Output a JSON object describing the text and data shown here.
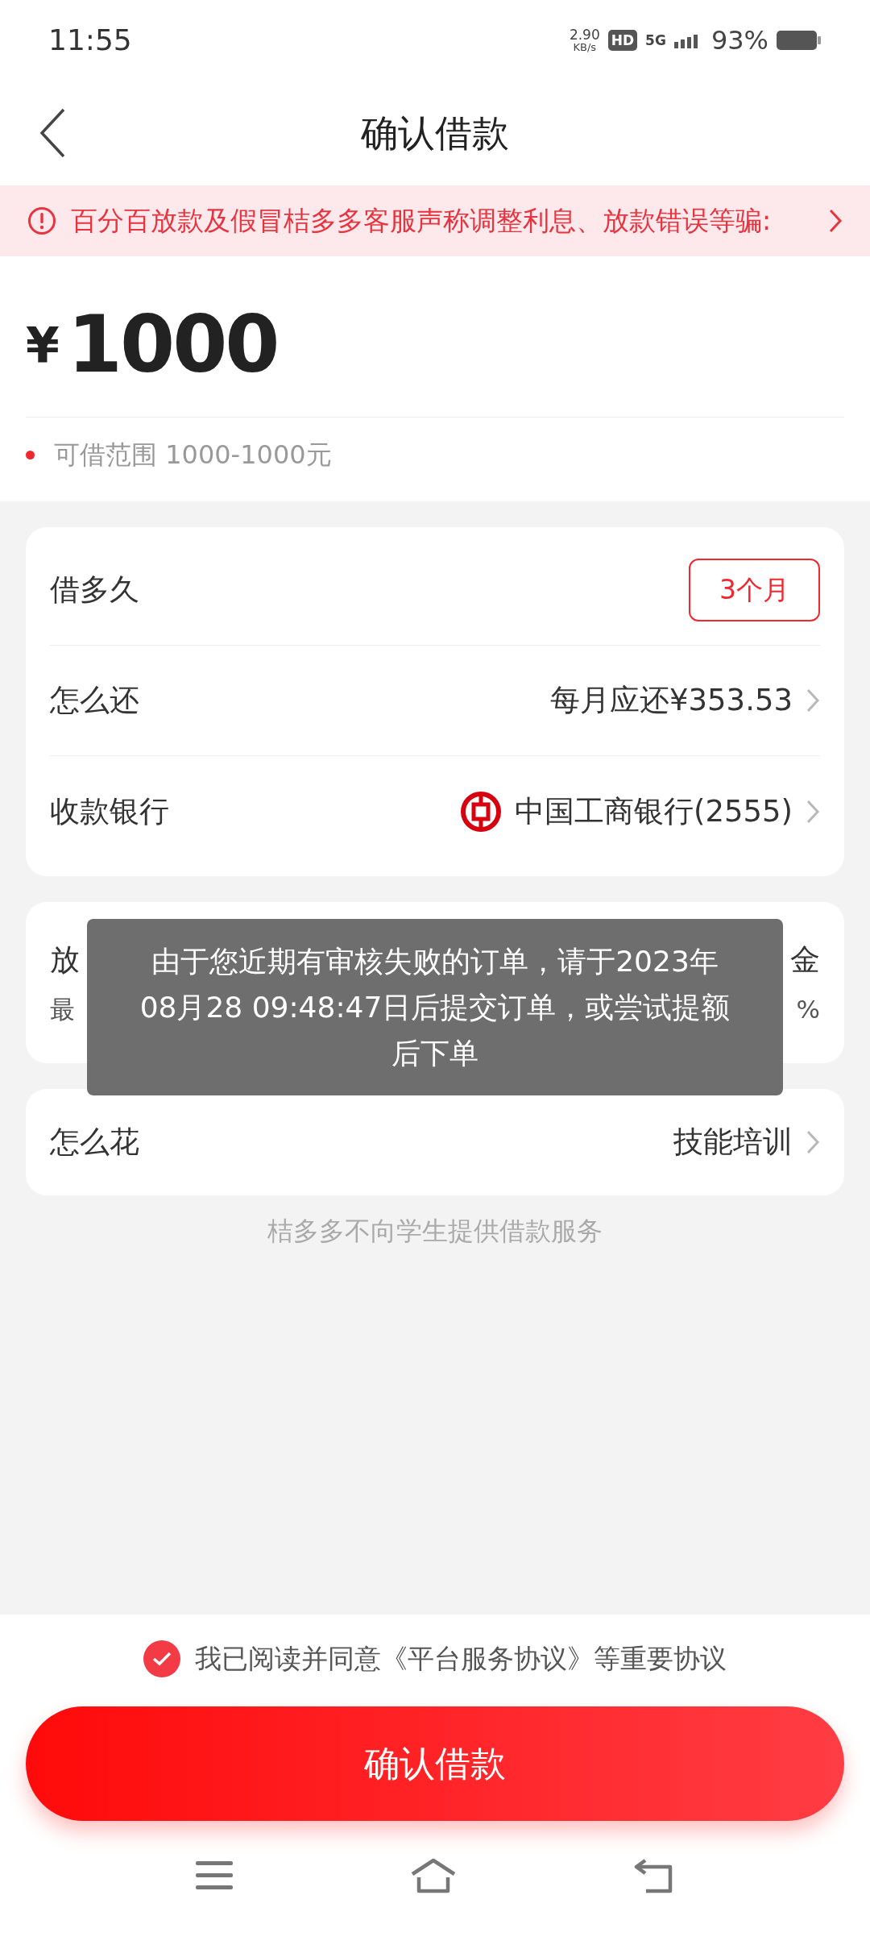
{
  "status_bar": {
    "time": "11:55",
    "net_speed": "2.90",
    "net_unit": "KB/s",
    "hd": "HD",
    "network": "5G",
    "battery": "93%"
  },
  "header": {
    "title": "确认借款"
  },
  "notice": {
    "text": "百分百放款及假冒桔多多客服声称调整利息、放款错误等骗:"
  },
  "amount": {
    "currency": "¥",
    "value": "1000",
    "range": "可借范围 1000-1000元"
  },
  "loan_card": [
    {
      "kind": "tag",
      "label": "借多久",
      "value": "3个月"
    },
    {
      "kind": "link",
      "label": "怎么还",
      "value": "每月应还¥353.53"
    },
    {
      "kind": "bank",
      "label": "收款银行",
      "value": "中国工商银行(2555)"
    }
  ],
  "lender_card": {
    "label": "放",
    "note": "最",
    "lender": "金",
    "rate": "%"
  },
  "purpose": {
    "label": "怎么花",
    "value": "技能培训"
  },
  "student_note": "桔多多不向学生提供借款服务",
  "toast": "由于您近期有审核失败的订单，请于2023年08月28 09:48:47日后提交订单，或尝试提额后下单",
  "agreement": {
    "checked": true,
    "text": "我已阅读并同意《平台服务协议》等重要协议"
  },
  "confirm_button": "确认借款"
}
